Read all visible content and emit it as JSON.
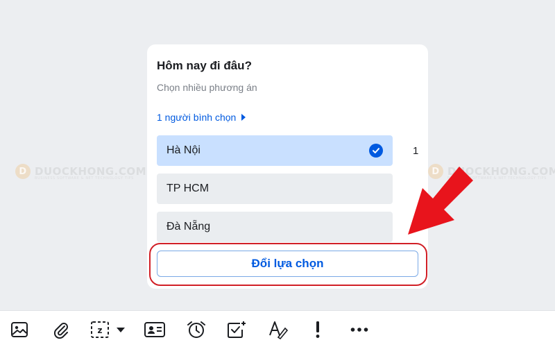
{
  "poll": {
    "title": "Hôm nay đi đâu?",
    "subtitle": "Chọn nhiều phương án",
    "voters_link": "1 người bình chọn",
    "options": [
      {
        "label": "Hà Nội",
        "votes": "1",
        "selected": true
      },
      {
        "label": "TP HCM",
        "votes": "",
        "selected": false
      },
      {
        "label": "Đà Nẵng",
        "votes": "",
        "selected": false
      }
    ],
    "change_button": "Đổi lựa chọn"
  },
  "watermark": {
    "text": "DUOCKHONG.COM",
    "badge": "D",
    "tagline": "BUSINESS SOFTWARE & NET TECHNOLOGY TIPS"
  },
  "colors": {
    "accent": "#005ae0",
    "selected_bg": "#c9e0ff",
    "highlight": "#d11f26",
    "arrow": "#e8141c"
  },
  "toolbar": {
    "icons": [
      "image-icon",
      "paperclip-icon",
      "screenshot-icon",
      "contact-card-icon",
      "alarm-clock-icon",
      "checkbox-task-icon",
      "text-format-icon",
      "exclamation-icon",
      "more-icon"
    ]
  }
}
